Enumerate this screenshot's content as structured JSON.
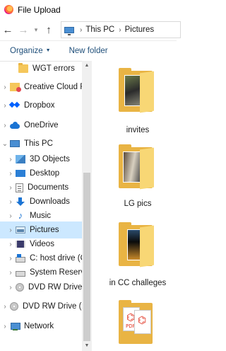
{
  "window": {
    "title": "File Upload"
  },
  "address_bar": {
    "location_icon": "this-pc-icon",
    "crumbs": [
      "This PC",
      "Pictures"
    ]
  },
  "command_bar": {
    "organize_label": "Organize",
    "new_folder_label": "New folder"
  },
  "nav": {
    "items": [
      {
        "label": "WGT errors",
        "icon": "folder-icon"
      },
      {
        "label": "Creative Cloud Files",
        "icon": "creative-cloud-files-icon"
      },
      {
        "label": "Dropbox",
        "icon": "dropbox-icon"
      },
      {
        "label": "OneDrive",
        "icon": "onedrive-icon"
      },
      {
        "label": "This PC",
        "icon": "this-pc-icon"
      },
      {
        "label": "3D Objects",
        "icon": "3d-objects-icon"
      },
      {
        "label": "Desktop",
        "icon": "desktop-icon"
      },
      {
        "label": "Documents",
        "icon": "documents-icon"
      },
      {
        "label": "Downloads",
        "icon": "downloads-icon"
      },
      {
        "label": "Music",
        "icon": "music-icon"
      },
      {
        "label": "Pictures",
        "icon": "pictures-icon",
        "selected": true
      },
      {
        "label": "Videos",
        "icon": "videos-icon"
      },
      {
        "label": "C: host drive (C:)",
        "icon": "windows-drive-icon"
      },
      {
        "label": "System Reserved",
        "icon": "drive-icon"
      },
      {
        "label": "DVD RW Drive (F:)",
        "icon": "dvd-drive-icon"
      },
      {
        "label": "DVD RW Drive (F:)",
        "icon": "dvd-drive-icon"
      },
      {
        "label": "Network",
        "icon": "network-icon"
      }
    ]
  },
  "content": {
    "folders": [
      {
        "name": "invites"
      },
      {
        "name": "LG pics"
      },
      {
        "name": "in CC challeges"
      },
      {
        "name": "",
        "thumbnail_text": "PDF"
      }
    ]
  }
}
